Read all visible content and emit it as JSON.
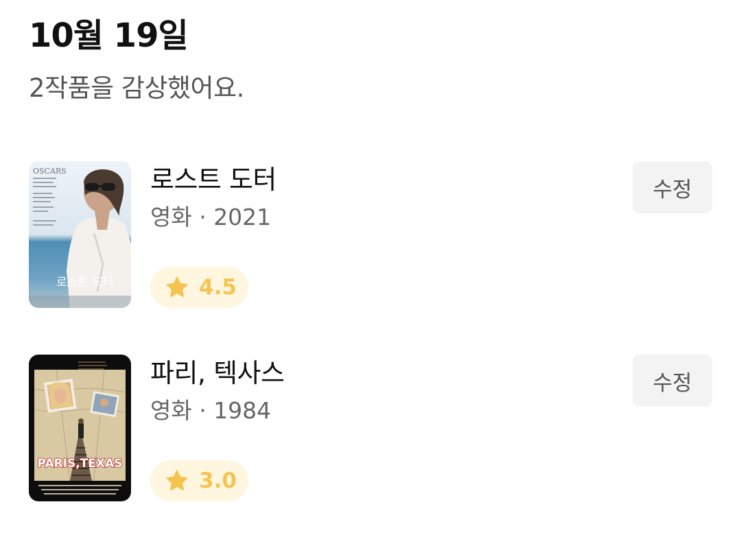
{
  "header": {
    "date": "10월 19일",
    "summary": "2작품을 감상했어요."
  },
  "entries": [
    {
      "title": "로스트 도터",
      "meta": "영화 · 2021",
      "rating": "4.5",
      "edit_label": "수정",
      "poster_texts": {
        "brand": "OSCARS",
        "title": "로스트 도터"
      }
    },
    {
      "title": "파리, 텍사스",
      "meta": "영화 · 1984",
      "rating": "3.0",
      "edit_label": "수정",
      "poster_texts": {
        "title": "PARIS,TEXAS"
      }
    }
  ],
  "colors": {
    "rating_bg": "#fff6e0",
    "star": "#f5c450",
    "edit_bg": "#f3f3f3"
  }
}
